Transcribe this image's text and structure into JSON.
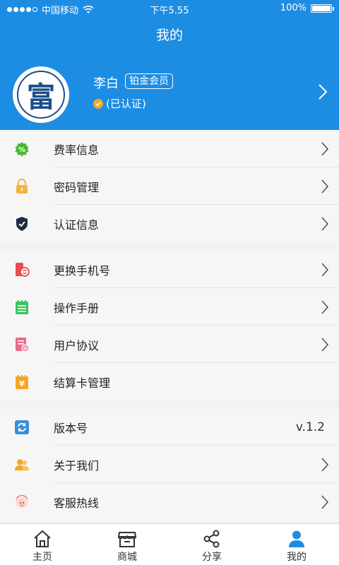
{
  "status_bar": {
    "carrier": "中国移动",
    "time": "下午5.55",
    "battery": "100%"
  },
  "header": {
    "title": "我的"
  },
  "profile": {
    "name": "李白",
    "member_level": "铂金会员",
    "verify_status": "(已认证)",
    "avatar_char": "富"
  },
  "menu_group_1": [
    {
      "label": "费率信息",
      "icon": "percent-icon",
      "color": "#4cb82c"
    },
    {
      "label": "密码管理",
      "icon": "lock-icon",
      "color": "#f5b53c"
    },
    {
      "label": "认证信息",
      "icon": "shield-icon",
      "color": "#1f2a44"
    }
  ],
  "menu_group_2": [
    {
      "label": "更换手机号",
      "icon": "phone-swap-icon",
      "color": "#e94b4b"
    },
    {
      "label": "操作手册",
      "icon": "notebook-icon",
      "color": "#38c460"
    },
    {
      "label": "用户协议",
      "icon": "agreement-icon",
      "color": "#e96a8c"
    },
    {
      "label": "结算卡管理",
      "icon": "yen-card-icon",
      "color": "#f5a623"
    }
  ],
  "menu_group_3": [
    {
      "label": "版本号",
      "icon": "refresh-icon",
      "value": "v.1.2",
      "color": "#3b8fd9"
    },
    {
      "label": "关于我们",
      "icon": "people-icon",
      "color": "#f5a623"
    },
    {
      "label": "客服热线",
      "icon": "service-icon",
      "color": "#ea5a7a"
    }
  ],
  "tabs": [
    {
      "label": "主页",
      "icon": "home-icon"
    },
    {
      "label": "商城",
      "icon": "store-icon"
    },
    {
      "label": "分享",
      "icon": "share-icon"
    },
    {
      "label": "我的",
      "icon": "user-icon",
      "active": true
    }
  ],
  "colors": {
    "primary": "#1d8de3",
    "background": "#f2f2f2"
  }
}
